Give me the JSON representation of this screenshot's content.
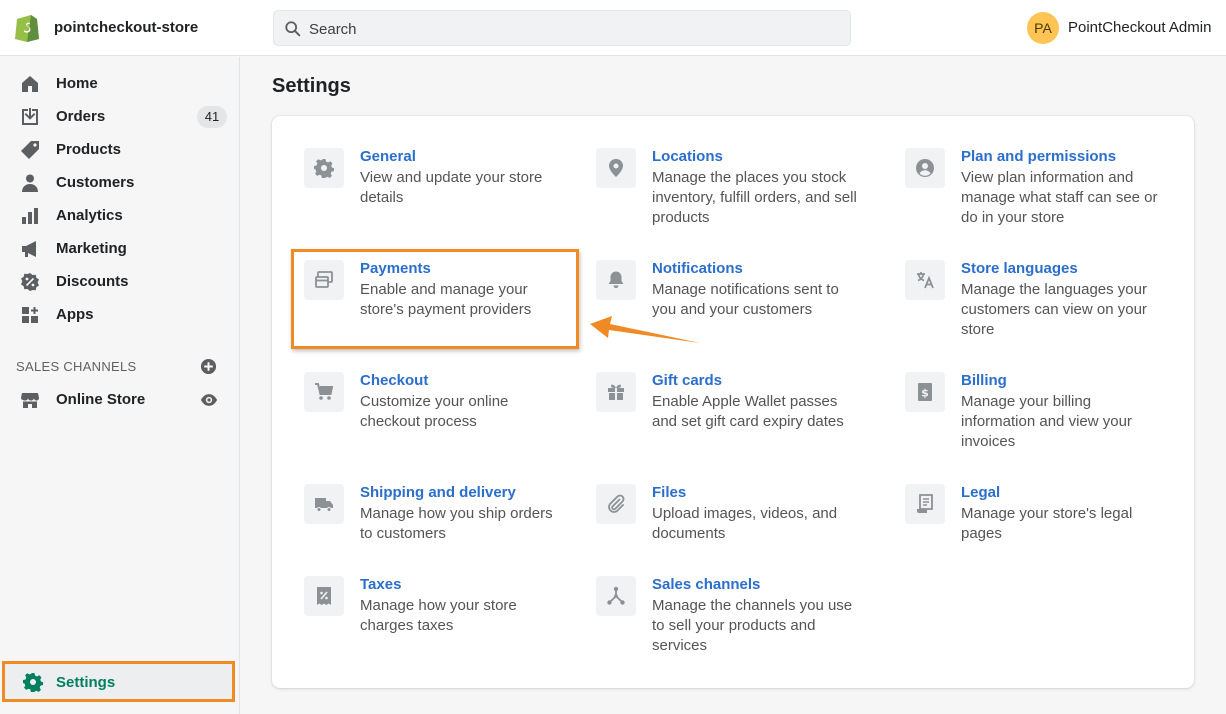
{
  "header": {
    "store_name": "pointcheckout-store",
    "search_placeholder": "Search",
    "avatar_initials": "PA",
    "user_name": "PointCheckout Admin"
  },
  "sidebar": {
    "items": [
      {
        "label": "Home",
        "icon": "home-icon"
      },
      {
        "label": "Orders",
        "icon": "orders-icon",
        "badge": "41"
      },
      {
        "label": "Products",
        "icon": "tag-icon"
      },
      {
        "label": "Customers",
        "icon": "person-icon"
      },
      {
        "label": "Analytics",
        "icon": "bar-chart-icon"
      },
      {
        "label": "Marketing",
        "icon": "megaphone-icon"
      },
      {
        "label": "Discounts",
        "icon": "discount-icon"
      },
      {
        "label": "Apps",
        "icon": "apps-icon"
      }
    ],
    "sales_channels_title": "SALES CHANNELS",
    "online_store_label": "Online Store",
    "settings_label": "Settings"
  },
  "main": {
    "page_title": "Settings",
    "tiles": [
      {
        "title": "General",
        "desc": "View and update your store details",
        "icon": "gear-icon"
      },
      {
        "title": "Locations",
        "desc": "Manage the places you stock inventory, fulfill orders, and sell products",
        "icon": "location-pin-icon"
      },
      {
        "title": "Plan and permissions",
        "desc": "View plan information and manage what staff can see or do in your store",
        "icon": "user-circle-icon"
      },
      {
        "title": "Payments",
        "desc": "Enable and manage your store's payment providers",
        "icon": "payments-icon"
      },
      {
        "title": "Notifications",
        "desc": "Manage notifications sent to you and your customers",
        "icon": "bell-icon"
      },
      {
        "title": "Store languages",
        "desc": "Manage the languages your customers can view on your store",
        "icon": "translate-icon"
      },
      {
        "title": "Checkout",
        "desc": "Customize your online checkout process",
        "icon": "cart-icon"
      },
      {
        "title": "Gift cards",
        "desc": "Enable Apple Wallet passes and set gift card expiry dates",
        "icon": "gift-icon"
      },
      {
        "title": "Billing",
        "desc": "Manage your billing information and view your invoices",
        "icon": "billing-icon"
      },
      {
        "title": "Shipping and delivery",
        "desc": "Manage how you ship orders to customers",
        "icon": "truck-icon"
      },
      {
        "title": "Files",
        "desc": "Upload images, videos, and documents",
        "icon": "paperclip-icon"
      },
      {
        "title": "Legal",
        "desc": "Manage your store's legal pages",
        "icon": "legal-icon"
      },
      {
        "title": "Taxes",
        "desc": "Manage how your store charges taxes",
        "icon": "taxes-icon"
      },
      {
        "title": "Sales channels",
        "desc": "Manage the channels you use to sell your products and services",
        "icon": "sales-channels-icon"
      }
    ]
  },
  "colors": {
    "accent_link": "#2c6ecb",
    "settings_green": "#008060",
    "highlight_orange": "#f08a24",
    "avatar_yellow": "#ffc453"
  }
}
